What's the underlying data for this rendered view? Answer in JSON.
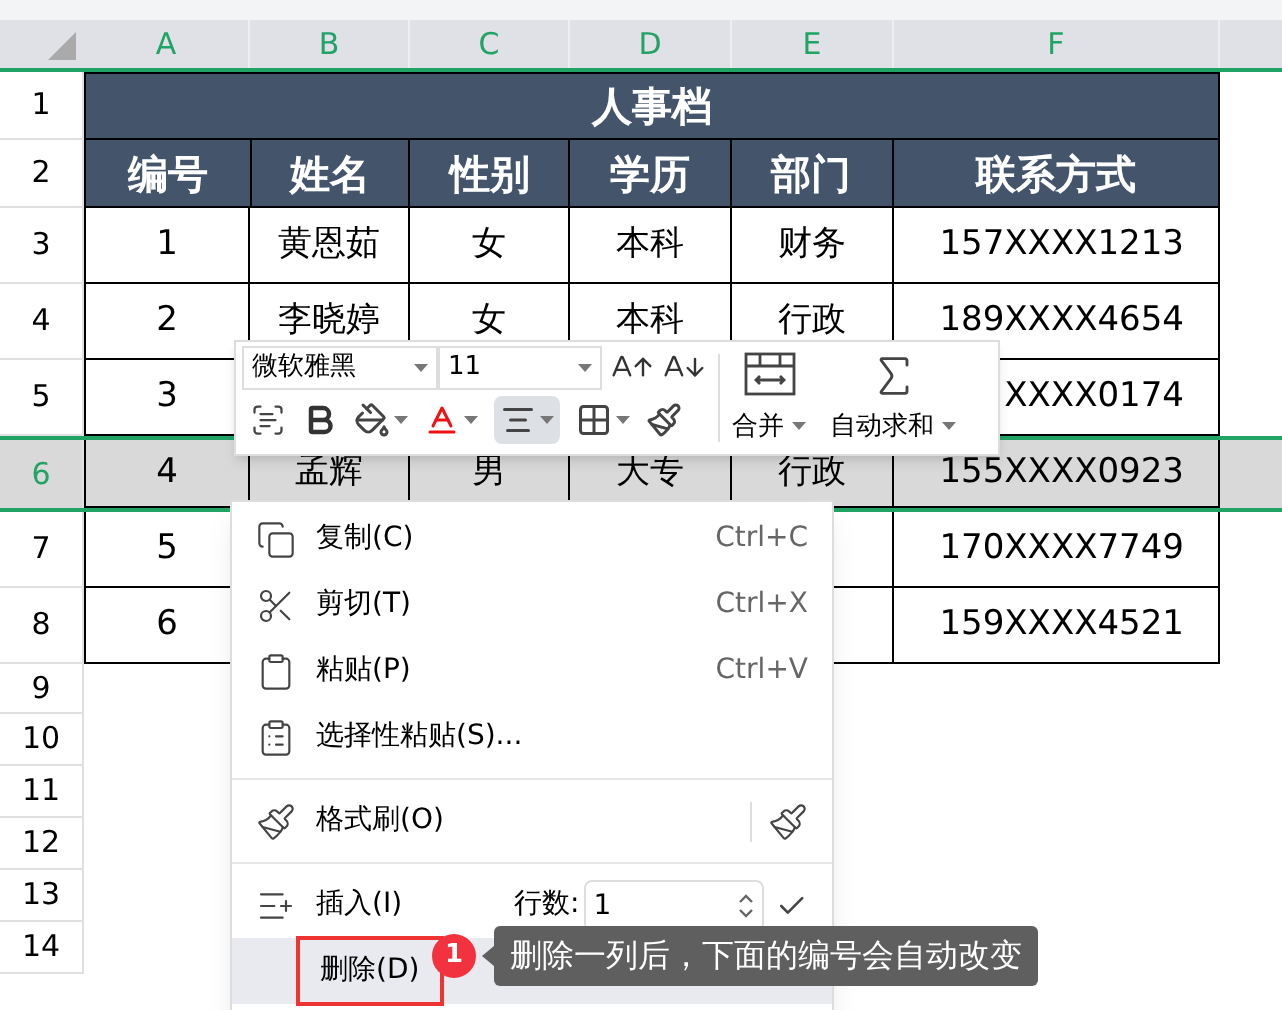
{
  "columns": [
    "A",
    "B",
    "C",
    "D",
    "E",
    "F"
  ],
  "row_numbers": [
    "1",
    "2",
    "3",
    "4",
    "5",
    "6",
    "7",
    "8",
    "9",
    "10",
    "11",
    "12",
    "13",
    "14"
  ],
  "title": "人事档",
  "headers": [
    "编号",
    "姓名",
    "性别",
    "学历",
    "部门",
    "联系方式"
  ],
  "rows": [
    {
      "selected": false,
      "cells": [
        "1",
        "黄恩茹",
        "女",
        "本科",
        "财务",
        "157XXXX1213"
      ]
    },
    {
      "selected": false,
      "cells": [
        "2",
        "李晓婷",
        "女",
        "本科",
        "行政",
        "189XXXX4654"
      ]
    },
    {
      "selected": false,
      "cells": [
        "3",
        null,
        null,
        null,
        null,
        "XXXX0174"
      ]
    },
    {
      "selected": true,
      "cells": [
        "4",
        "孟辉",
        "男",
        "大专",
        "行政",
        "155XXXX0923"
      ]
    },
    {
      "selected": false,
      "cells": [
        "5",
        null,
        null,
        null,
        null,
        "170XXXX7749"
      ]
    },
    {
      "selected": false,
      "cells": [
        "6",
        null,
        null,
        null,
        null,
        "159XXXX4521"
      ]
    }
  ],
  "toolbar": {
    "font": "微软雅黑",
    "size": "11",
    "align_center_selected": true,
    "merge": "合并",
    "autosum": "自动求和"
  },
  "menu": {
    "items": [
      {
        "kind": "item",
        "label": "复制(C)",
        "shortcut": "Ctrl+C",
        "selected": false
      },
      {
        "kind": "item",
        "label": "剪切(T)",
        "shortcut": "Ctrl+X",
        "selected": false
      },
      {
        "kind": "item",
        "label": "粘贴(P)",
        "shortcut": "Ctrl+V",
        "selected": false
      },
      {
        "kind": "item",
        "label": "选择性粘贴(S)...",
        "selected": false
      },
      {
        "kind": "separator"
      },
      {
        "kind": "painter",
        "label": "格式刷(O)",
        "selected": false
      },
      {
        "kind": "separator"
      },
      {
        "kind": "insert",
        "label": "插入(I)",
        "count_label": "行数:",
        "count": "1",
        "selected": false
      },
      {
        "kind": "item",
        "label": "删除(D)",
        "selected": true,
        "outlined": true
      }
    ]
  },
  "callout": {
    "badge": "1",
    "text": "删除一列后，下面的编号会自动改变"
  }
}
